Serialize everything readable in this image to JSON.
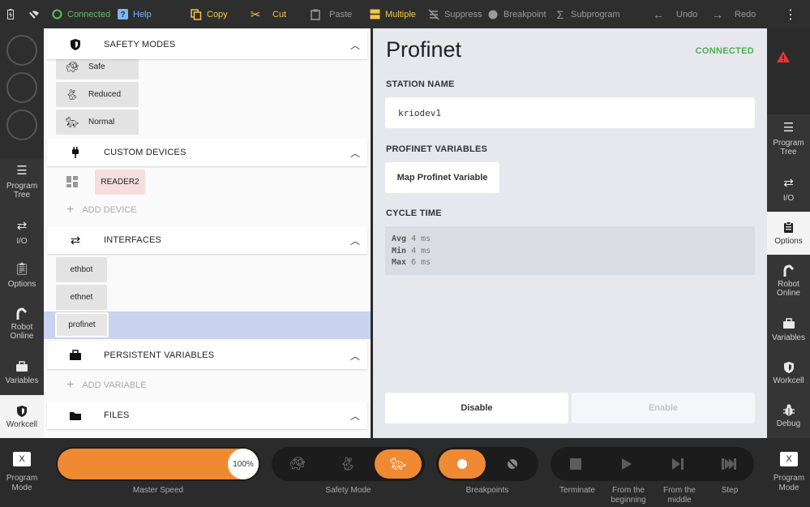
{
  "topbar": {
    "connected_label": "Connected",
    "help_label": "Help",
    "copy_label": "Copy",
    "cut_label": "Cut",
    "paste_label": "Paste",
    "multiple_label": "Multiple",
    "suppress_label": "Suppress",
    "breakpoint_label": "Breakpoint",
    "subprogram_label": "Subprogram",
    "undo_label": "Undo",
    "redo_label": "Redo",
    "icons": [
      "battery-icon",
      "wifi-off-icon",
      "connected-circle-icon",
      "help-icon",
      "copy-icon",
      "scissors-icon",
      "clipboard-icon",
      "multiple-icon",
      "suppress-icon",
      "breakpoint-dot-icon",
      "sigma-icon",
      "arrow-left-icon",
      "arrow-right-icon",
      "more-vert-icon"
    ],
    "colors": {
      "accent": "#f5c542",
      "connected": "#5dc35d"
    }
  },
  "left_rail": {
    "items": [
      {
        "label": "Program Tree",
        "icon": "list-icon"
      },
      {
        "label": "I/O",
        "icon": "io-arrows-icon"
      },
      {
        "label": "Options",
        "icon": "clipboard-icon"
      },
      {
        "label": "Robot Online",
        "icon": "robot-arm-icon"
      },
      {
        "label": "Variables",
        "icon": "briefcase-icon"
      },
      {
        "label": "Workcell",
        "icon": "shield-icon"
      }
    ]
  },
  "middle": {
    "safety": {
      "title": "SAFETY MODES",
      "modes": [
        {
          "label": "Safe",
          "icon": "turtle-icon"
        },
        {
          "label": "Reduced",
          "icon": "rabbit-icon"
        },
        {
          "label": "Normal",
          "icon": "cheetah-icon"
        }
      ]
    },
    "custom_devices": {
      "title": "CUSTOM DEVICES",
      "device": "READER2",
      "add_label": "ADD DEVICE"
    },
    "interfaces": {
      "title": "INTERFACES",
      "items": [
        "ethbot",
        "ethnet",
        "profinet"
      ],
      "selected": "profinet"
    },
    "persistent": {
      "title": "PERSISTENT VARIABLES",
      "add_label": "ADD VARIABLE"
    },
    "files": {
      "title": "FILES"
    }
  },
  "content": {
    "title": "Profinet",
    "status": "CONNECTED",
    "station_label": "STATION NAME",
    "station_value": "kriodev1",
    "variables_label": "PROFINET VARIABLES",
    "map_button": "Map Profinet Variable",
    "cycle_label": "CYCLE TIME",
    "cycle": {
      "avg_key": "Avg",
      "avg_val": "4 ms",
      "min_key": "Min",
      "min_val": "4 ms",
      "max_key": "Max",
      "max_val": "6 ms"
    },
    "disable_button": "Disable",
    "enable_button": "Enable"
  },
  "right_rail": {
    "items": [
      {
        "label": "Program Tree",
        "icon": "list-icon"
      },
      {
        "label": "I/O",
        "icon": "io-arrows-icon"
      },
      {
        "label": "Options",
        "icon": "clipboard-icon"
      },
      {
        "label": "Robot Online",
        "icon": "robot-arm-icon"
      },
      {
        "label": "Variables",
        "icon": "briefcase-icon"
      },
      {
        "label": "Workcell",
        "icon": "shield-icon"
      },
      {
        "label": "Debug",
        "icon": "bug-icon"
      }
    ]
  },
  "bottom": {
    "program_mode_left": "Program Mode",
    "program_mode_right": "Program Mode",
    "x_label": "X",
    "speed_value": "100%",
    "speed_fraction": 1.0,
    "master_speed_label": "Master Speed",
    "safety_mode_label": "Safety Mode",
    "breakpoints_label": "Breakpoints",
    "terminate_label": "Terminate",
    "from_beginning_label": "From the beginning",
    "from_middle_label": "From the middle",
    "step_label": "Step",
    "colors": {
      "orange": "#ef8a33"
    }
  }
}
